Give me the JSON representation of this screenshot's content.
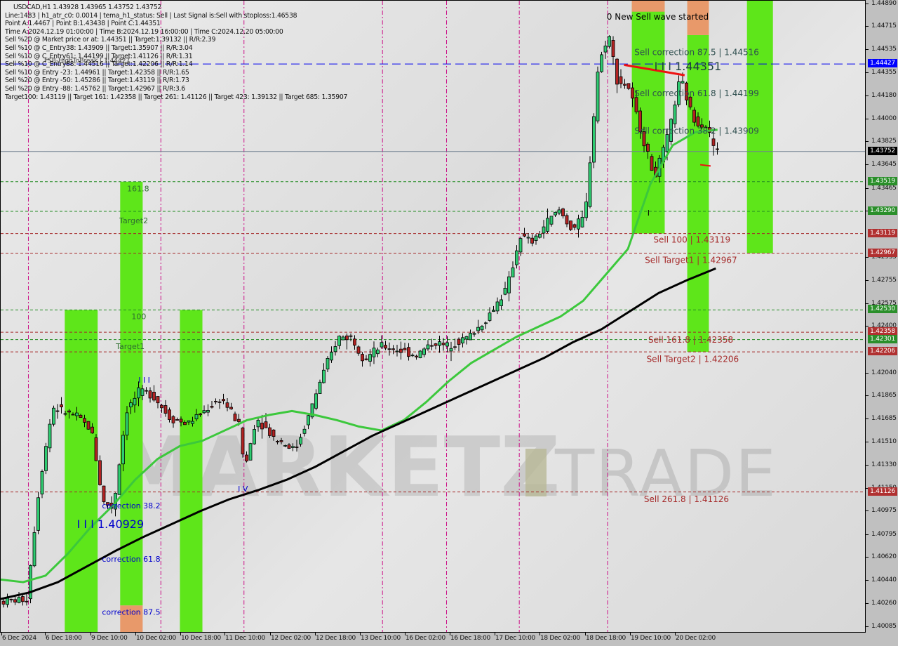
{
  "header": {
    "symbol_line": "USDCAD,H1  1.43928 1.43965 1.43752 1.43752",
    "lines": [
      "Line:1483 | h1_atr_c0: 0.0014 | tema_h1_status: Sell | Last Signal is:Sell with stoploss:1.46538",
      "Point A:1.4467 | Point B:1.43438 | Point C:1.44351",
      "Time A:2024.12.19 01:00:00 | Time B:2024.12.19 16:00:00 | Time C:2024.12.20 05:00:00",
      "Sell %20 @ Market price or at: 1.44351 || Target:1.39132 || R/R:2.39",
      "Sell %10 @ C_Entry38: 1.43909 || Target:1.35907 || R/R:3.04",
      "Sell %10 @ C_Entry61: 1.44199 || Target:1.41126 || R/R:1.31",
      "Sell %10 @ C_Entry88: 1.44516 || Target:1.42206 || R/R:1.14",
      "Sell %10 @ Entry -23: 1.44961 || Target:1.42358 || R/R:1.65",
      "Sell %20 @ Entry -50: 1.45286 || Target:1.43119 || R/R:1.73",
      "Sell %20 @ Entry -88: 1.45762 || Target:1.42967 || R/R:3.6",
      "Target100: 1.43119 || Target 161: 1.42358 || Target 261: 1.41126 || Target 423: 1.39132 || Target 685: 1.35907"
    ],
    "overlay_text": "FSB-HighToBreak | 1.44427"
  },
  "colors": {
    "bull": "#2ecc71",
    "bear": "#b22222",
    "green_zone": "#5ee61a",
    "orange_zone": "#e8996a",
    "ema_green": "#3cc83c",
    "ema_black": "#000000",
    "level_red": "#a52a2a",
    "level_green": "#228b22",
    "fsb_blue": "#0000ee",
    "vline": "#cc1188",
    "orange_dash": "#ff5a00",
    "badge_blue": "#0000ff",
    "badge_black": "#000000",
    "badge_green": "#2a8f2a",
    "badge_red": "#b03030"
  },
  "chart_data": {
    "type": "candlestick",
    "title": "USDCAD,H1",
    "ylim": [
      1.40035,
      1.44915
    ],
    "price_ticks": [
      "1.44890",
      "1.44715",
      "1.44535",
      "1.44355",
      "1.44180",
      "1.44000",
      "1.43825",
      "1.43645",
      "1.43465",
      "1.43290",
      "1.42935",
      "1.42755",
      "1.42575",
      "1.42400",
      "1.42040",
      "1.41865",
      "1.41685",
      "1.41510",
      "1.41330",
      "1.41150",
      "1.40975",
      "1.40795",
      "1.40620",
      "1.40440",
      "1.40260",
      "1.40085"
    ],
    "time_ticks": [
      "6 Dec 2024",
      "6 Dec 18:00",
      "9 Dec 10:00",
      "10 Dec 02:00",
      "10 Dec 18:00",
      "11 Dec 10:00",
      "12 Dec 02:00",
      "12 Dec 18:00",
      "13 Dec 10:00",
      "16 Dec 02:00",
      "16 Dec 18:00",
      "17 Dec 10:00",
      "18 Dec 02:00",
      "18 Dec 18:00",
      "19 Dec 10:00",
      "20 Dec 02:00"
    ],
    "price_badges": [
      {
        "value": "1.44427",
        "kind": "blue"
      },
      {
        "value": "1.43752",
        "kind": "black"
      },
      {
        "value": "1.43519",
        "kind": "green"
      },
      {
        "value": "1.43290",
        "kind": "green"
      },
      {
        "value": "1.43119",
        "kind": "red"
      },
      {
        "value": "1.42967",
        "kind": "red"
      },
      {
        "value": "1.42530",
        "kind": "green"
      },
      {
        "value": "1.42358",
        "kind": "red"
      },
      {
        "value": "1.42301",
        "kind": "green"
      },
      {
        "value": "1.42206",
        "kind": "red"
      },
      {
        "value": "1.41126",
        "kind": "red"
      }
    ],
    "levels": [
      {
        "price": 1.44427,
        "kind": "blue"
      },
      {
        "price": 1.43752,
        "kind": "current"
      },
      {
        "price": 1.43519,
        "kind": "green"
      },
      {
        "price": 1.4329,
        "kind": "green"
      },
      {
        "price": 1.43119,
        "kind": "red"
      },
      {
        "price": 1.42967,
        "kind": "red"
      },
      {
        "price": 1.4253,
        "kind": "green"
      },
      {
        "price": 1.42358,
        "kind": "red"
      },
      {
        "price": 1.42301,
        "kind": "green"
      },
      {
        "price": 1.42206,
        "kind": "red"
      },
      {
        "price": 1.41126,
        "kind": "red"
      }
    ],
    "annotations": [
      {
        "text": "0 New Sell wave started",
        "price": 1.4479,
        "bar": 0.7,
        "color": "#000000",
        "size": "large"
      },
      {
        "text": "Sell correction 87.5 | 1.44516",
        "price": 1.44516,
        "bar": 0.732,
        "color": "#2f4f4f",
        "size": "large"
      },
      {
        "text": "I I I  1.44351",
        "price": 1.444,
        "bar": 0.755,
        "color": "#1f3f3f",
        "size": "xl"
      },
      {
        "text": "Sell correction 61.8 | 1.44199",
        "price": 1.44199,
        "bar": 0.732,
        "color": "#2f4f4f",
        "size": "large"
      },
      {
        "text": "Sell correction 38.2 | 1.43909",
        "price": 1.43909,
        "bar": 0.732,
        "color": "#2f4f4f",
        "size": "large"
      },
      {
        "text": "Sell 100 | 1.43119",
        "price": 1.4307,
        "bar": 0.754,
        "color": "#a52a2a",
        "size": "large"
      },
      {
        "text": "Sell Target1 | 1.42967",
        "price": 1.42915,
        "bar": 0.744,
        "color": "#a52a2a",
        "size": "large"
      },
      {
        "text": "Sell 161.8 | 1.42358",
        "price": 1.423,
        "bar": 0.748,
        "color": "#a52a2a",
        "size": "large"
      },
      {
        "text": "Sell Target2 | 1.42206",
        "price": 1.4215,
        "bar": 0.746,
        "color": "#a52a2a",
        "size": "large"
      },
      {
        "text": "Sell  261.8 | 1.41126",
        "price": 1.4107,
        "bar": 0.743,
        "color": "#a52a2a",
        "size": "large"
      },
      {
        "text": "161.8",
        "price": 1.43465,
        "bar": 0.146,
        "color": "#2f6f2f",
        "size": "small"
      },
      {
        "text": "Target2",
        "price": 1.4322,
        "bar": 0.137,
        "color": "#2f6f2f",
        "size": "small"
      },
      {
        "text": "100",
        "price": 1.4248,
        "bar": 0.151,
        "color": "#2f6f2f",
        "size": "small"
      },
      {
        "text": "Target1",
        "price": 1.4225,
        "bar": 0.133,
        "color": "#2f6f2f",
        "size": "small"
      },
      {
        "text": "correction 38.2",
        "price": 1.4102,
        "bar": 0.117,
        "color": "#0000cc",
        "size": "small"
      },
      {
        "text": "I I I 1.40929",
        "price": 1.4087,
        "bar": 0.088,
        "color": "#0000cc",
        "size": "xl"
      },
      {
        "text": "correction 61.8",
        "price": 1.4061,
        "bar": 0.117,
        "color": "#0000cc",
        "size": "small"
      },
      {
        "text": "correction 87.5",
        "price": 1.402,
        "bar": 0.117,
        "color": "#0000cc",
        "size": "small"
      },
      {
        "text": "I I I",
        "price": 1.4199,
        "bar": 0.159,
        "color": "#0000cc",
        "size": "small"
      },
      {
        "text": "I V",
        "price": 1.4115,
        "bar": 0.274,
        "color": "#0000cc",
        "size": "small"
      },
      {
        "text": "I",
        "price": 1.4328,
        "bar": 0.747,
        "color": "#000000",
        "size": "small"
      }
    ],
    "series": [
      {
        "name": "EMA green",
        "values": [
          1.4045,
          1.4043,
          1.4048,
          1.4065,
          1.4085,
          1.4102,
          1.4122,
          1.4138,
          1.4148,
          1.4152,
          1.416,
          1.4168,
          1.4172,
          1.4175,
          1.4172,
          1.4168,
          1.4163,
          1.416,
          1.4168,
          1.4182,
          1.4198,
          1.4212,
          1.4222,
          1.4232,
          1.424,
          1.4248,
          1.426,
          1.428,
          1.43,
          1.435,
          1.438,
          1.439,
          1.4392
        ]
      },
      {
        "name": "SMA black",
        "values": [
          1.403,
          1.4035,
          1.4043,
          1.4055,
          1.4067,
          1.4078,
          1.4088,
          1.4098,
          1.4107,
          1.4114,
          1.4122,
          1.4132,
          1.4144,
          1.4156,
          1.4166,
          1.4176,
          1.4186,
          1.4196,
          1.4206,
          1.4216,
          1.4228,
          1.4238,
          1.4252,
          1.4266,
          1.4276,
          1.4285
        ]
      }
    ]
  },
  "watermark": {
    "left": "MARKETZ",
    "right": "TRADE"
  }
}
